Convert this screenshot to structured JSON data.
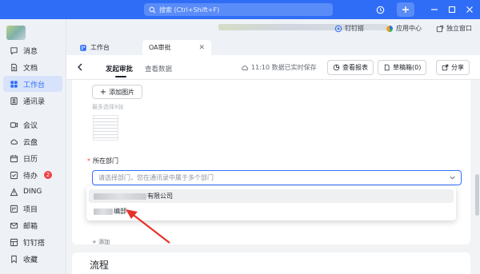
{
  "titlebar": {
    "search_placeholder": "搜索 (Ctrl+Shift+F)"
  },
  "sidebar": {
    "items": [
      {
        "label": "消息",
        "icon": "message-icon"
      },
      {
        "label": "文档",
        "icon": "document-icon"
      },
      {
        "label": "工作台",
        "icon": "workbench-icon",
        "active": true
      },
      {
        "label": "通讯录",
        "icon": "contacts-icon"
      },
      {
        "label": "会议",
        "icon": "meeting-icon"
      },
      {
        "label": "云盘",
        "icon": "cloud-drive-icon"
      },
      {
        "label": "日历",
        "icon": "calendar-icon"
      },
      {
        "label": "待办",
        "icon": "todo-icon",
        "badge": "2"
      },
      {
        "label": "DING",
        "icon": "ding-icon"
      },
      {
        "label": "项目",
        "icon": "project-icon"
      },
      {
        "label": "邮箱",
        "icon": "mail-icon"
      },
      {
        "label": "钉钉搭",
        "icon": "dingtalk-builder-icon"
      },
      {
        "label": "收藏",
        "icon": "favorites-icon"
      }
    ]
  },
  "topbar": {
    "dingtalk_builder": "钉钉搭",
    "app_center": "应用中心",
    "independent_window": "独立窗口"
  },
  "tabs": [
    {
      "label": "工作台"
    },
    {
      "label": "OA审批",
      "active": true
    }
  ],
  "header": {
    "tab_initiate": "发起审批",
    "tab_view_data": "查看数据",
    "save_status": "11:10 数据已实时保存",
    "view_report": "查看报表",
    "drafts": "草稿箱(0)",
    "share": "分享"
  },
  "form": {
    "add_image": "添加图片",
    "image_hint": "最多选择9张",
    "dept_label": "所在部门",
    "dept_placeholder": "请选择部门，您在通讯录中属于多个部门",
    "dept_options": [
      {
        "visible_text": "有限公司"
      },
      {
        "visible_text": "编部"
      }
    ],
    "add_below": "添加"
  },
  "process": {
    "title": "流程"
  },
  "colors": {
    "primary": "#2f6df6",
    "accent_blue": "#3370ff",
    "required": "#f54a45",
    "badge": "#f04142"
  }
}
